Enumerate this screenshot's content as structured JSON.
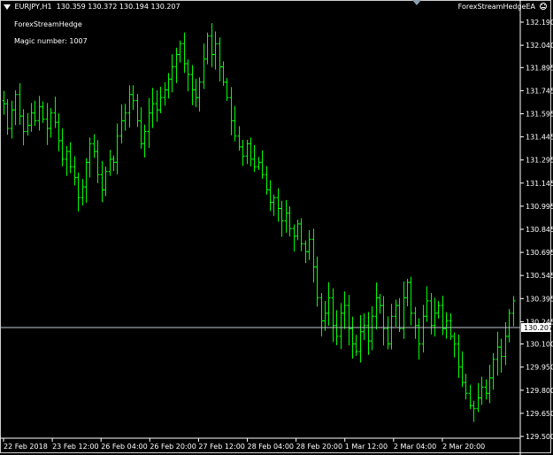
{
  "header": {
    "symbol": "EURJPY,H1",
    "ohlc": "130.359 130.372 130.194 130.207"
  },
  "ea": {
    "name": "ForexStreamHedge",
    "magic": "Magic number: 1007",
    "top_right_label": "ForexStreamHedgeEA"
  },
  "colors": {
    "background": "#000000",
    "candles": "#00ff00",
    "axis": "#ffffff",
    "price_line": "#c0c8d0"
  },
  "icons": {
    "ea_status": "smiley-icon",
    "symbol_menu": "triangle-down-icon",
    "chart_shift": "triangle-marker-icon"
  },
  "chart_data": {
    "type": "bar",
    "subtype": "ohlc",
    "title": "",
    "xlabel": "",
    "ylabel": "",
    "ylim": [
      129.45,
      132.25
    ],
    "yticks": [
      "132.190",
      "132.040",
      "131.895",
      "131.745",
      "131.595",
      "131.445",
      "131.295",
      "131.145",
      "130.995",
      "130.845",
      "130.695",
      "130.545",
      "130.395",
      "130.245",
      "130.100",
      "129.950",
      "129.800",
      "129.650",
      "129.500"
    ],
    "xticks": [
      "22 Feb 2018",
      "23 Feb 12:00",
      "26 Feb 04:00",
      "26 Feb 20:00",
      "27 Feb 12:00",
      "28 Feb 04:00",
      "28 Feb 20:00",
      "1 Mar 12:00",
      "2 Mar 04:00",
      "2 Mar 20:00"
    ],
    "current_price": 130.207,
    "current_price_label": "130.207",
    "close": [
      131.66,
      131.5,
      131.62,
      131.72,
      131.58,
      131.48,
      131.52,
      131.6,
      131.55,
      131.64,
      131.56,
      131.5,
      131.6,
      131.54,
      131.42,
      131.3,
      131.35,
      131.25,
      131.18,
      131.05,
      131.12,
      131.28,
      131.4,
      131.35,
      131.2,
      131.1,
      131.22,
      131.3,
      131.28,
      131.45,
      131.55,
      131.6,
      131.72,
      131.68,
      131.55,
      131.4,
      131.48,
      131.6,
      131.66,
      131.62,
      131.7,
      131.75,
      131.82,
      131.9,
      131.98,
      132.05,
      131.92,
      131.85,
      131.75,
      131.7,
      131.8,
      131.95,
      132.1,
      131.98,
      132.05,
      131.9,
      131.8,
      131.7,
      131.55,
      131.45,
      131.38,
      131.32,
      131.4,
      131.3,
      131.25,
      131.28,
      131.2,
      131.1,
      131.02,
      131.05,
      130.98,
      130.9,
      130.95,
      130.85,
      130.8,
      130.88,
      130.75,
      130.7,
      130.78,
      130.6,
      130.4,
      130.25,
      130.3,
      130.4,
      130.22,
      130.15,
      130.3,
      130.35,
      130.2,
      130.1,
      130.05,
      130.18,
      130.22,
      130.12,
      130.28,
      130.4,
      130.35,
      130.2,
      130.1,
      130.28,
      130.35,
      130.2,
      130.4,
      130.5,
      130.3,
      130.22,
      130.1,
      130.28,
      130.38,
      130.22,
      130.3,
      130.35,
      130.2,
      130.25,
      130.15,
      130.1,
      129.95,
      129.85,
      129.78,
      129.7,
      129.68,
      129.75,
      129.82,
      129.78,
      129.88,
      130.0,
      130.08,
      130.02,
      130.15,
      130.3,
      130.38
    ]
  }
}
